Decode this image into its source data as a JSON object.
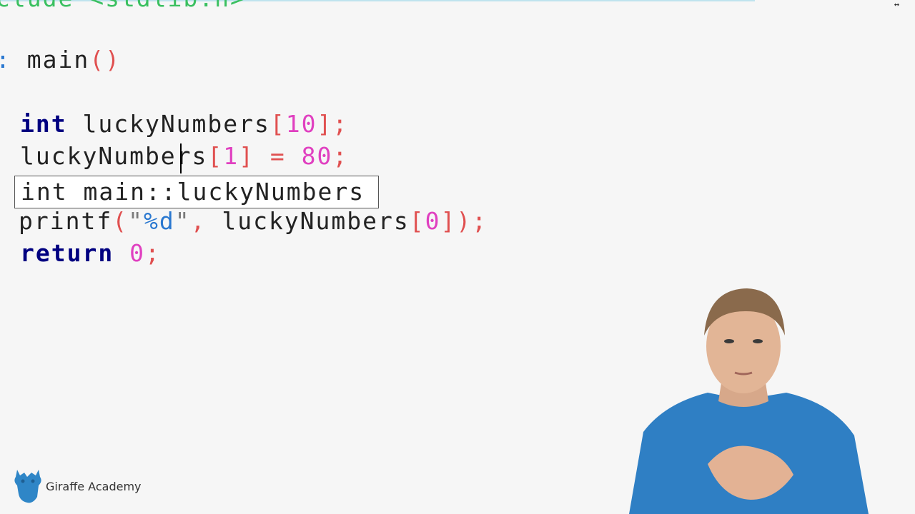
{
  "editor": {
    "include_line": "clude <stdlib.h>",
    "main_decl": {
      "type_fragment": ":",
      "name": " main",
      "parens": "()"
    },
    "line_decl": {
      "keyword": "int",
      "ident": " luckyNumbers",
      "bracket_open": "[",
      "size": "10",
      "bracket_close": "]",
      "semi": ";"
    },
    "line_assign": {
      "ident": "luckyNumbers",
      "bracket_open": "[",
      "index": "1",
      "bracket_close": "]",
      "eq": " = ",
      "value": "80",
      "semi": ";"
    },
    "line_printf": {
      "fn": "printf",
      "paren_open": "(",
      "quote_open": "\"",
      "format": "%d",
      "quote_close": "\"",
      "comma": ",",
      "arg": " luckyNumbers",
      "bracket_open": "[",
      "index": "0",
      "bracket_close": "]",
      "paren_close": ")",
      "semi": ";"
    },
    "line_return": {
      "keyword": "return",
      "value": "0",
      "semi": ";"
    },
    "tooltip": "int main::luckyNumbers"
  },
  "branding": {
    "logo_icon": "giraffe-icon",
    "logo_text": "Giraffe Academy"
  },
  "colors": {
    "background": "#f6f6f6",
    "keyword": "#000080",
    "number": "#e040c0",
    "operator": "#e05050",
    "format_spec": "#2a78d0",
    "logo": "#2f86c7"
  }
}
